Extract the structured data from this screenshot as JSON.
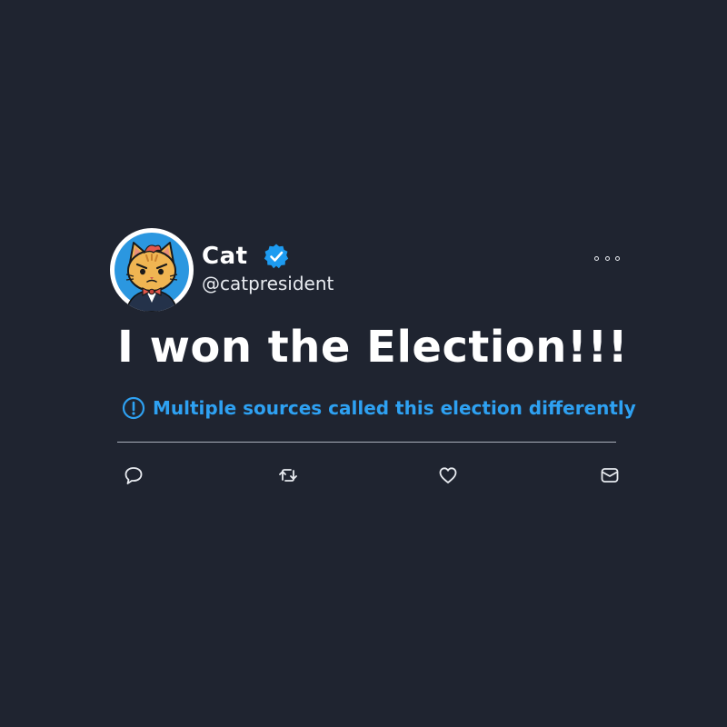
{
  "user": {
    "display_name": "Cat",
    "handle": "@catpresident",
    "verified": true,
    "avatar": "cat-president-avatar"
  },
  "tweet": {
    "text": "I won the Election!!!",
    "notice": "Multiple sources called this election differently",
    "notice_icon": "exclamation-circle-icon"
  },
  "actions": [
    {
      "name": "reply",
      "icon": "comment-icon"
    },
    {
      "name": "retweet",
      "icon": "retweet-icon"
    },
    {
      "name": "like",
      "icon": "heart-icon"
    },
    {
      "name": "share",
      "icon": "share-icon"
    }
  ],
  "colors": {
    "background": "#1f2430",
    "text": "#ffffff",
    "accent": "#2ea1f2",
    "verified": "#1d9bf0",
    "divider": "#aab0bb"
  }
}
